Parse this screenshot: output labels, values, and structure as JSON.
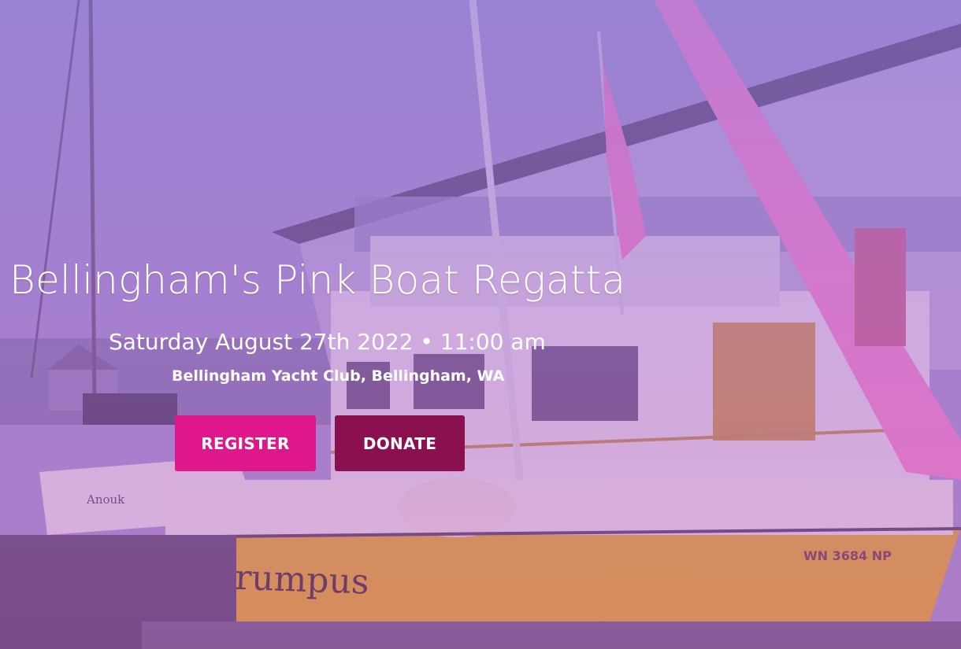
{
  "hero": {
    "title": "Bellingham's Pink Boat Regatta",
    "datetime": "Saturday August 27th 2022 • 11:00 am",
    "venue": "Bellingham Yacht Club, Bellingham, WA",
    "register_label": "REGISTER",
    "donate_label": "DONATE"
  },
  "photo": {
    "boat_name": "wild rumpus",
    "boat_number": "WN 3684 NP",
    "stern_name": "Anouk"
  },
  "colors": {
    "register": "#e0168b",
    "donate": "#8a1050",
    "overlay": "#9b82d2",
    "hull": "#e8b020"
  }
}
